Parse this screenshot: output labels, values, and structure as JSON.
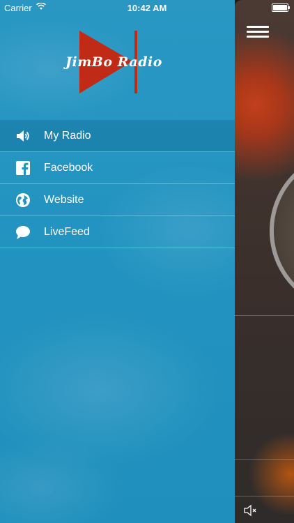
{
  "status_bar": {
    "carrier": "Carrier",
    "time": "10:42 AM",
    "wifi_icon": "wifi-icon",
    "battery_icon": "battery-icon"
  },
  "logo": {
    "text": "JimBo Radio",
    "color_play": "#bf2b16",
    "color_bar": "#bf2b16"
  },
  "menu": {
    "items": [
      {
        "label": "My Radio",
        "icon": "speaker-icon",
        "active": true
      },
      {
        "label": "Facebook",
        "icon": "facebook-icon",
        "active": false
      },
      {
        "label": "Website",
        "icon": "globe-icon",
        "active": false
      },
      {
        "label": "LiveFeed",
        "icon": "chat-bubble-icon",
        "active": false
      }
    ]
  },
  "content": {
    "menu_icon": "hamburger-icon",
    "mute_icon": "speaker-mute-icon"
  },
  "colors": {
    "drawer_bg": "#2394c1",
    "text": "#ffffff"
  }
}
